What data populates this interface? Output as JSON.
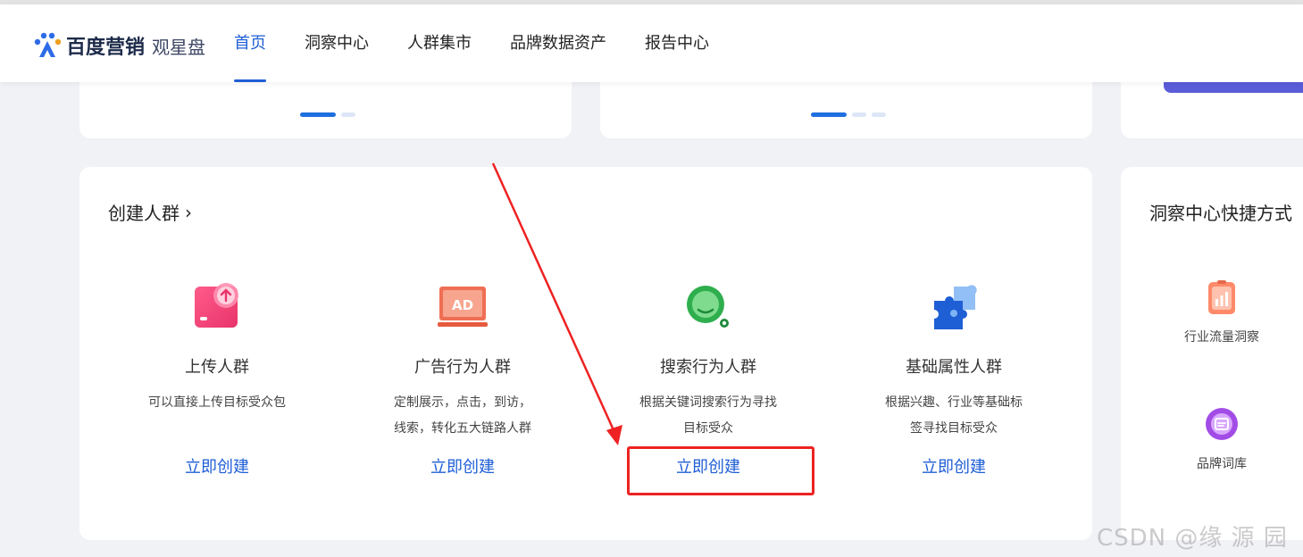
{
  "header": {
    "logo_text": "百度营销",
    "logo_sub": "观星盘",
    "nav": [
      {
        "label": "首页",
        "active": true
      },
      {
        "label": "洞察中心",
        "active": false
      },
      {
        "label": "人群集市",
        "active": false
      },
      {
        "label": "品牌数据资产",
        "active": false
      },
      {
        "label": "报告中心",
        "active": false
      }
    ]
  },
  "create_section": {
    "title": "创建人群",
    "items": [
      {
        "icon": "upload-icon",
        "title": "上传人群",
        "desc_line1": "可以直接上传目标受众包",
        "desc_line2": "",
        "link": "立即创建"
      },
      {
        "icon": "ad-icon",
        "title": "广告行为人群",
        "desc_line1": "定制展示，点击，到访，",
        "desc_line2": "线索，转化五大链路人群",
        "link": "立即创建"
      },
      {
        "icon": "search-icon",
        "title": "搜索行为人群",
        "desc_line1": "根据关键词搜索行为寻找",
        "desc_line2": "目标受众",
        "link": "立即创建"
      },
      {
        "icon": "puzzle-icon",
        "title": "基础属性人群",
        "desc_line1": "根据兴趣、行业等基础标",
        "desc_line2": "签寻找目标受众",
        "link": "立即创建"
      }
    ]
  },
  "side_section": {
    "title": "洞察中心快捷方式",
    "items": [
      {
        "icon": "industry-traffic-icon",
        "label": "行业流量洞察"
      },
      {
        "icon": "brand-lexicon-icon",
        "label": "品牌词库"
      }
    ]
  },
  "watermark": "CSDN @缘 源 园",
  "colors": {
    "accent": "#1f5fd6",
    "highlight": "#ee2222",
    "purple": "#5b5cd8"
  }
}
